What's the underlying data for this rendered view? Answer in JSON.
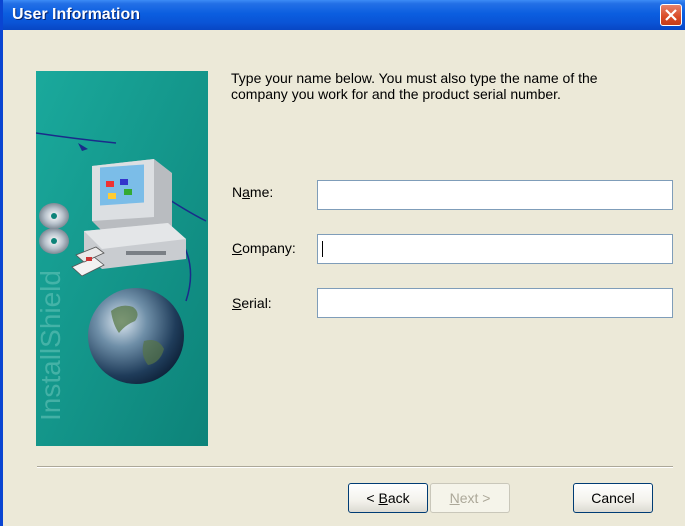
{
  "window": {
    "title": "User Information",
    "close_label": "close"
  },
  "banner": {
    "brand_text": "InstallShield"
  },
  "instructions": "Type your name below. You must also type the name of the company you work for and the product serial number.",
  "fields": {
    "name": {
      "label_pre": "N",
      "label_ul": "a",
      "label_post": "me:",
      "value": ""
    },
    "company": {
      "label_pre": "",
      "label_ul": "C",
      "label_post": "ompany:",
      "value": ""
    },
    "serial": {
      "label_pre": "",
      "label_ul": "S",
      "label_post": "erial:",
      "value": ""
    }
  },
  "buttons": {
    "back": {
      "pre": "< ",
      "ul": "B",
      "post": "ack"
    },
    "next": {
      "pre": "",
      "ul": "N",
      "post": "ext >"
    },
    "cancel": "Cancel"
  },
  "colors": {
    "title_bar": "#0a54d6",
    "dialog_bg": "#ece9d8",
    "banner_teal": "#129b8f"
  }
}
